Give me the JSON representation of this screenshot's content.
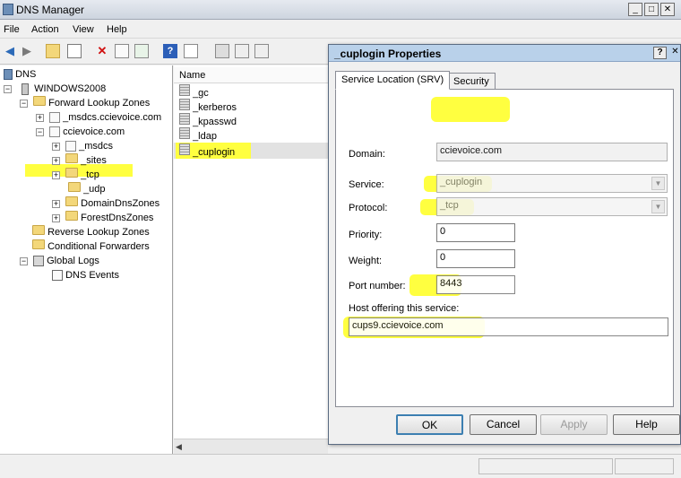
{
  "window": {
    "title": "DNS Manager",
    "minimize": "_",
    "maximize": "□",
    "close": "✕"
  },
  "menu": [
    "File",
    "Action",
    "View",
    "Help"
  ],
  "tree": {
    "root": "DNS",
    "server": "WINDOWS2008",
    "forward_zones": "Forward Lookup Zones",
    "msdcs_zone": "_msdcs.ccievoice.com",
    "zone": "ccievoice.com",
    "msdcs": "_msdcs",
    "sites": "_sites",
    "tcp": "_tcp",
    "udp": "_udp",
    "domain_dns": "DomainDnsZones",
    "forest_dns": "ForestDnsZones",
    "reverse_zones": "Reverse Lookup Zones",
    "conditional": "Conditional Forwarders",
    "global_logs": "Global Logs",
    "dns_events": "DNS Events"
  },
  "list": {
    "header": "Name",
    "items": [
      "_gc",
      "_kerberos",
      "_kpasswd",
      "_ldap",
      "_cuplogin"
    ]
  },
  "dialog": {
    "title": "_cuplogin Properties",
    "help": "?",
    "close": "✕",
    "tabs": [
      "Service Location (SRV)",
      "Security"
    ],
    "domain_label": "Domain:",
    "domain_value": "ccievoice.com",
    "service_label": "Service:",
    "service_value": "_cuplogin",
    "protocol_label": "Protocol:",
    "protocol_value": "_tcp",
    "priority_label": "Priority:",
    "priority_value": "0",
    "weight_label": "Weight:",
    "weight_value": "0",
    "port_label": "Port number:",
    "port_value": "8443",
    "host_label": "Host offering this service:",
    "host_value": "cups9.ccievoice.com",
    "buttons": {
      "ok": "OK",
      "cancel": "Cancel",
      "apply": "Apply",
      "help": "Help"
    }
  },
  "colors": {
    "highlight": "#ffff40",
    "title_active": "#b9d1ea"
  }
}
